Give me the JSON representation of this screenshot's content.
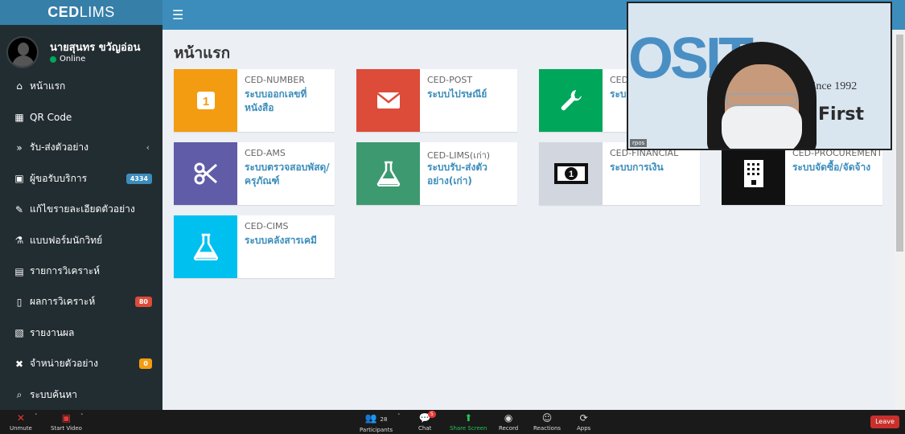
{
  "app": {
    "logo_bold": "CED",
    "logo_rest": "LIMS"
  },
  "user": {
    "name": "นายสุนทร ขวัญอ่อน",
    "status": "Online"
  },
  "sidebar": {
    "items": [
      {
        "label": "หน้าแรก",
        "icon": "home-icon"
      },
      {
        "label": "QR Code",
        "icon": "qrcode-icon"
      },
      {
        "label": "รับ-ส่งตัวอย่าง",
        "icon": "double-chevron-icon",
        "chevron": "‹"
      },
      {
        "label": "ผู้ขอรับบริการ",
        "icon": "id-card-icon",
        "badge": "4334",
        "badge_color": "#3c8dbc"
      },
      {
        "label": "แก้ไขรายละเอียดตัวอย่าง",
        "icon": "edit-icon"
      },
      {
        "label": "แบบฟอร์มนักวิทย์",
        "icon": "flask-icon"
      },
      {
        "label": "รายการวิเคราะห์",
        "icon": "book-icon"
      },
      {
        "label": "ผลการวิเคราะห์",
        "icon": "file-icon",
        "badge": "80",
        "badge_color": "#dd4b39"
      },
      {
        "label": "รายงานผล",
        "icon": "pdf-icon"
      },
      {
        "label": "จำหน่ายตัวอย่าง",
        "icon": "times-icon",
        "badge": "0",
        "badge_color": "#f39c12"
      },
      {
        "label": "ระบบค้นหา",
        "icon": "search-doc-icon"
      }
    ]
  },
  "page": {
    "title": "หน้าแรก"
  },
  "tiles": [
    {
      "code": "CED-NUMBER",
      "name": "ระบบออกเลขที่หนังสือ",
      "color": "#f39c12",
      "icon": "number-one-icon"
    },
    {
      "code": "CED-POST",
      "name": "ระบบไปรษณีย์",
      "color": "#dd4b39",
      "icon": "envelope-icon"
    },
    {
      "code": "CED-",
      "name": "ระบ",
      "color": "#00a65a",
      "icon": "wrench-icon"
    },
    {
      "code": "CED-AMS",
      "name": "ระบบตรวจสอบพัสดุ/ครุภัณฑ์",
      "color": "#605ca8",
      "icon": "scissors-icon"
    },
    {
      "code": "CED-LIMS(เก่า)",
      "name": "ระบบรับ-ส่งตัวอย่าง(เก่า)",
      "color": "#3d9970",
      "icon": "flask-icon"
    },
    {
      "code": "CED-FINANCIAL",
      "name": "ระบบการเงิน",
      "color": "#d2d6de",
      "icon": "money-icon"
    },
    {
      "code": "CED-PROCUREMENT",
      "name": "ระบบจัดซื้อ/จัดจ้าง",
      "color": "#111111",
      "icon": "building-icon"
    },
    {
      "code": "CED-CIMS",
      "name": "ระบบคลังสารเคมี",
      "color": "#00c0ef",
      "icon": "flask-icon"
    }
  ],
  "video": {
    "logo": "OSIT",
    "since": "since 1992",
    "tagline": "First",
    "label": "rpos"
  },
  "zoom": {
    "unmute": "Unmute",
    "start_video": "Start Video",
    "participants": "Participants",
    "participants_count": "28",
    "chat": "Chat",
    "chat_badge": "5",
    "share_screen": "Share Screen",
    "record": "Record",
    "reactions": "Reactions",
    "apps": "Apps",
    "leave": "Leave"
  }
}
